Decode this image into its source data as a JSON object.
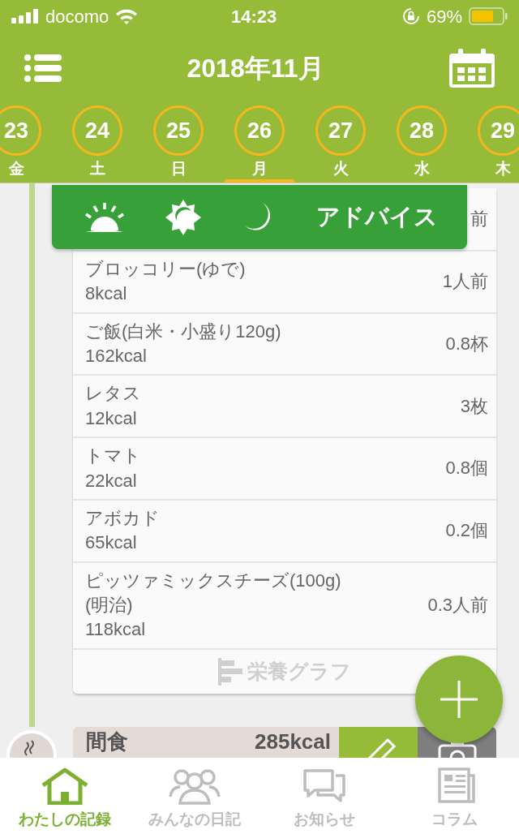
{
  "status_bar": {
    "carrier": "docomo",
    "time": "14:23",
    "battery": "69%"
  },
  "header": {
    "title": "2018年11月"
  },
  "days": [
    {
      "date": "23",
      "weekday": "金",
      "selected": false
    },
    {
      "date": "24",
      "weekday": "土",
      "selected": false
    },
    {
      "date": "25",
      "weekday": "日",
      "selected": false
    },
    {
      "date": "26",
      "weekday": "月",
      "selected": true
    },
    {
      "date": "27",
      "weekday": "火",
      "selected": false
    },
    {
      "date": "28",
      "weekday": "水",
      "selected": false
    },
    {
      "date": "29",
      "weekday": "木",
      "selected": false
    }
  ],
  "advice_bar": {
    "label": "アドバイス"
  },
  "meal_items": [
    {
      "quantity": "前"
    },
    {
      "name": "ブロッコリー(ゆで)",
      "kcal": "8kcal",
      "quantity": "1人前"
    },
    {
      "name": "ご飯(白米・小盛り120g)",
      "kcal": "162kcal",
      "quantity": "0.8杯"
    },
    {
      "name": "レタス",
      "kcal": "12kcal",
      "quantity": "3枚"
    },
    {
      "name": "トマト",
      "kcal": "22kcal",
      "quantity": "0.8個"
    },
    {
      "name": "アボカド",
      "kcal": "65kcal",
      "quantity": "0.2個"
    },
    {
      "name": "ピッツァミックスチーズ(100g)\n(明治)",
      "kcal": "118kcal",
      "quantity": "0.3人前"
    }
  ],
  "graph_button": {
    "label": "栄養グラフ"
  },
  "snack": {
    "label": "間食",
    "kcal": "285kcal"
  },
  "tabs": [
    {
      "label": "わたしの記録",
      "selected": true
    },
    {
      "label": "みんなの日記",
      "selected": false
    },
    {
      "label": "お知らせ",
      "selected": false
    },
    {
      "label": "コラム",
      "selected": false
    }
  ]
}
